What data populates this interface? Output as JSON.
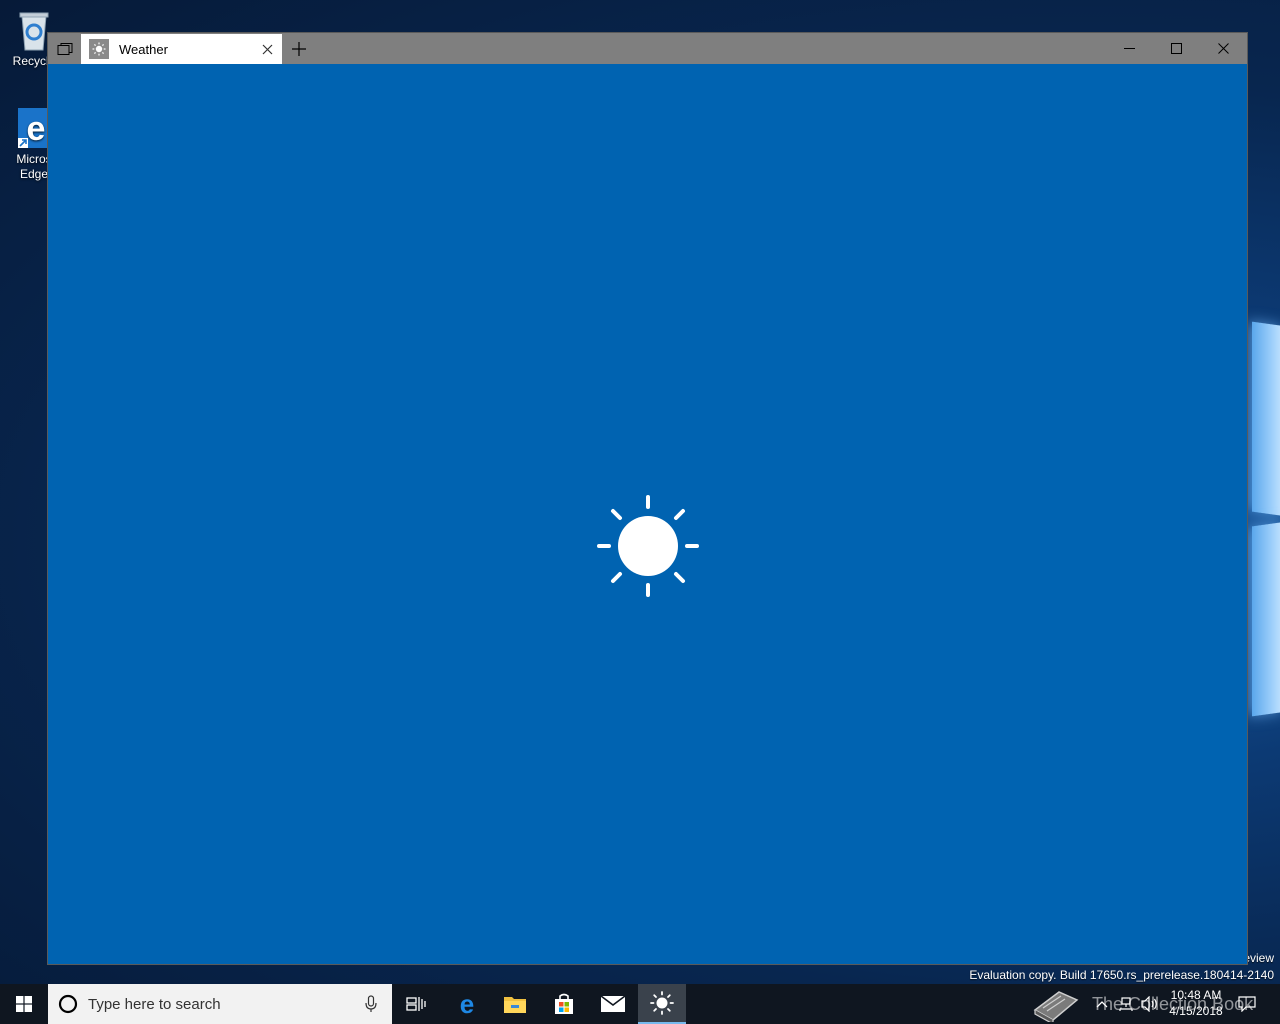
{
  "desktop": {
    "icons": [
      {
        "label": "Recycle",
        "icon": "recycle-bin-icon"
      },
      {
        "label": "Micros\nEdge",
        "icon": "edge-icon"
      }
    ],
    "watermark_line1": "eview",
    "watermark_line2": "Evaluation copy. Build 17650.rs_prerelease.180414-2140"
  },
  "window": {
    "tab_title": "Weather",
    "accent": "#0063b1",
    "titlebar_color": "#7f7f7f",
    "splash_icon": "sun-icon"
  },
  "taskbar": {
    "search_placeholder": "Type here to search",
    "pinned": [
      "task-view-icon",
      "edge-icon",
      "file-explorer-icon",
      "store-icon",
      "mail-icon",
      "weather-icon"
    ],
    "active_app": "weather-icon",
    "clock_time": "10:48 AM",
    "clock_date": "4/15/2018",
    "overlay_watermark": "The Collection Book"
  }
}
